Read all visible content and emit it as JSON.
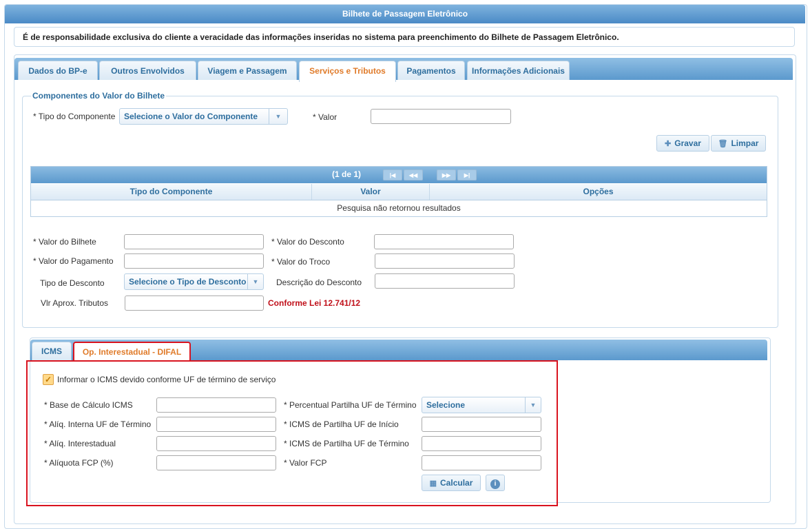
{
  "page_title": "Bilhete de Passagem Eletrônico",
  "notice": "É de responsabilidade exclusiva do cliente a veracidade das informações inseridas no sistema para preenchimento do Bilhete de Passagem Eletrônico.",
  "tabs": [
    {
      "label": "Dados do BP-e",
      "active": false
    },
    {
      "label": "Outros Envolvidos",
      "active": false
    },
    {
      "label": "Viagem e Passagem",
      "active": false
    },
    {
      "label": "Serviços e Tributos",
      "active": true
    },
    {
      "label": "Pagamentos",
      "active": false
    },
    {
      "label": "Informações Adicionais",
      "active": false
    }
  ],
  "componentes": {
    "legend": "Componentes do Valor do Bilhete",
    "tipo_label": "* Tipo do Componente",
    "tipo_value": "Selecione o Valor do Componente",
    "valor_label": "* Valor",
    "valor_value": "",
    "gravar": "Gravar",
    "limpar": "Limpar",
    "grid": {
      "pager": "(1 de 1)",
      "columns": [
        "Tipo do Componente",
        "Valor",
        "Opções"
      ],
      "empty": "Pesquisa não retornou resultados"
    },
    "valor_bilhete_label": "* Valor do Bilhete",
    "valor_desconto_label": "* Valor do Desconto",
    "valor_pagamento_label": "* Valor do Pagamento",
    "valor_troco_label": "* Valor do Troco",
    "tipo_desconto_label": "Tipo de Desconto",
    "tipo_desconto_value": "Selecione o Tipo de Desconto",
    "descricao_desconto_label": "Descrição do Desconto",
    "vlr_tributos_label": "Vlr Aprox. Tributos",
    "lei_text": "Conforme Lei 12.741/12"
  },
  "inner_tabs": [
    {
      "label": "ICMS",
      "active": false
    },
    {
      "label": "Op. Interestadual - DIFAL",
      "active": true
    }
  ],
  "difal": {
    "checkbox_label": "Informar o ICMS devido conforme UF de término de serviço",
    "checked": true,
    "base_calculo_label": "* Base de Cálculo ICMS",
    "aliq_interna_label": "* Alíq. Interna UF de Término",
    "aliq_interestadual_label": "* Alíq. Interestadual",
    "aliquota_fcp_label": "* Alíquota FCP (%)",
    "percentual_partilha_label": "* Percentual Partilha UF de Término",
    "percentual_partilha_value": "Selecione",
    "icms_partilha_inicio_label": "* ICMS de Partilha UF de Início",
    "icms_partilha_termino_label": "* ICMS de Partilha UF de Término",
    "valor_fcp_label": "* Valor FCP",
    "calcular": "Calcular"
  },
  "colors": {
    "accent": "#2e6e9e",
    "active_tab": "#e07b2a",
    "highlight_border": "#d9131f",
    "law_text": "#c0101a"
  }
}
